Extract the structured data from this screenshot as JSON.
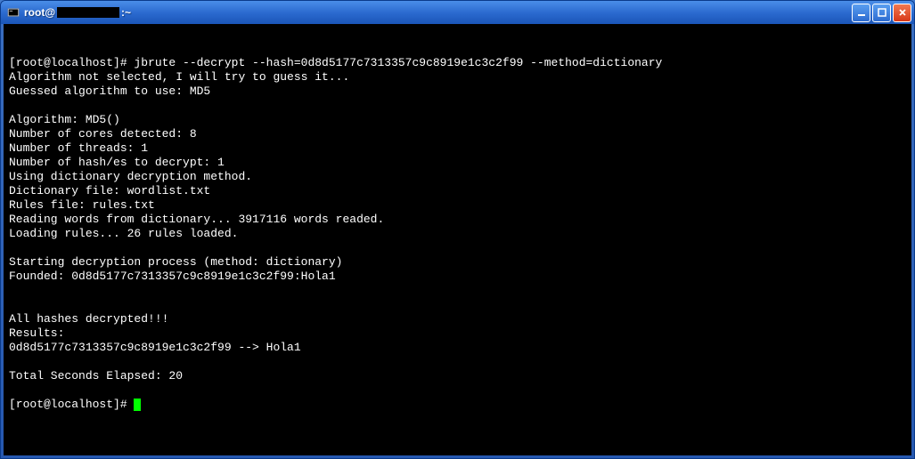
{
  "titlebar": {
    "prefix": "root@",
    "suffix": ":~"
  },
  "terminal": {
    "lines": [
      "[root@localhost]# jbrute --decrypt --hash=0d8d5177c7313357c9c8919e1c3c2f99 --method=dictionary",
      "Algorithm not selected, I will try to guess it...",
      "Guessed algorithm to use: MD5",
      "",
      "Algorithm: MD5()",
      "Number of cores detected: 8",
      "Number of threads: 1",
      "Number of hash/es to decrypt: 1",
      "Using dictionary decryption method.",
      "Dictionary file: wordlist.txt",
      "Rules file: rules.txt",
      "Reading words from dictionary... 3917116 words readed.",
      "Loading rules... 26 rules loaded.",
      "",
      "Starting decryption process (method: dictionary)",
      "Founded: 0d8d5177c7313357c9c8919e1c3c2f99:Hola1",
      "",
      "",
      "All hashes decrypted!!!",
      "Results:",
      "0d8d5177c7313357c9c8919e1c3c2f99 --> Hola1",
      "",
      "Total Seconds Elapsed: 20",
      "",
      "[root@localhost]# "
    ]
  }
}
